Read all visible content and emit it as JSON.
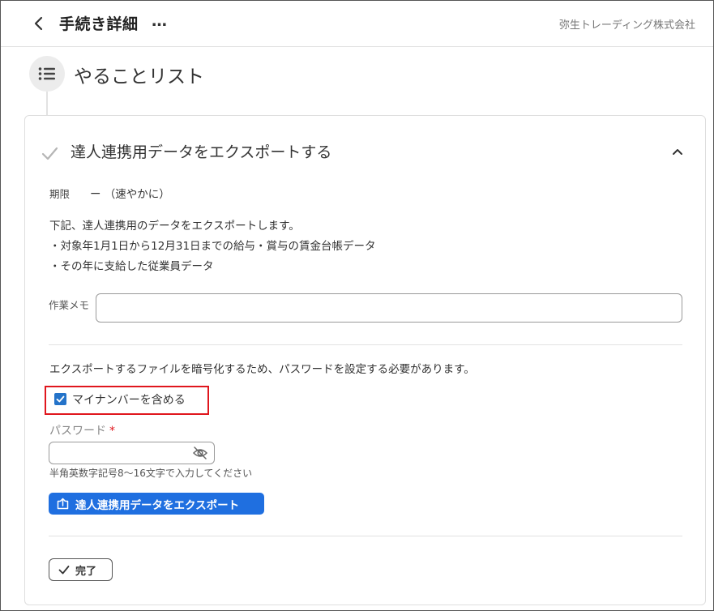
{
  "header": {
    "title": "手続き詳細",
    "more": "…",
    "company": "弥生トレーディング株式会社"
  },
  "section": {
    "title": "やることリスト"
  },
  "task": {
    "title": "達人連携用データをエクスポートする",
    "deadline_label": "期限",
    "deadline_value": "ー （速やかに）",
    "description": [
      "下記、達人連携用のデータをエクスポートします。",
      "・対象年1月1日から12月31日までの給与・賞与の賃金台帳データ",
      "・その年に支給した従業員データ"
    ],
    "memo_label": "作業メモ",
    "memo_value": "",
    "encrypt_note": "エクスポートするファイルを暗号化するため、パスワードを設定する必要があります。",
    "mynumber_label": "マイナンバーを含める",
    "mynumber_checked": true,
    "password_label": "パスワード",
    "password_required": "*",
    "password_value": "",
    "password_hint": "半角英数字記号8〜16文字で入力してください",
    "export_button": "達人連携用データをエクスポート",
    "done_button": "完了"
  },
  "colors": {
    "primary": "#1f6fe0",
    "checkbox": "#2473c9",
    "highlight": "#e0161d",
    "required": "#e0161d"
  },
  "icons": {
    "back": "chevron-left-icon",
    "list": "list-icon",
    "check": "checkmark-icon",
    "collapse": "chevron-up-icon",
    "eye": "eye-off-icon",
    "export": "upload-icon",
    "done": "checkmark-icon"
  }
}
